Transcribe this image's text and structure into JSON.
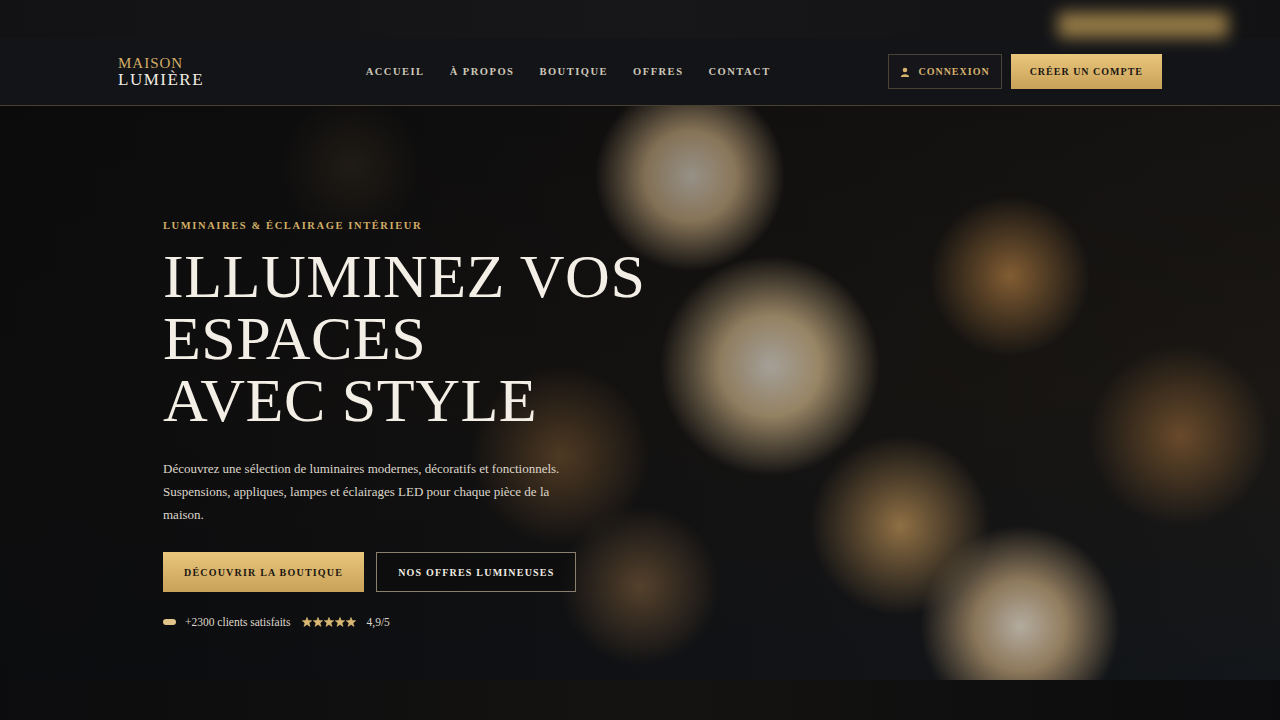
{
  "brand": {
    "line1": "MAISON",
    "line2": "LUMIÈRE"
  },
  "nav": [
    {
      "label": "ACCUEIL"
    },
    {
      "label": "À PROPOS"
    },
    {
      "label": "BOUTIQUE"
    },
    {
      "label": "OFFRES"
    },
    {
      "label": "CONTACT"
    }
  ],
  "account": {
    "login": "CONNEXION",
    "signup": "CRÉER UN COMPTE"
  },
  "hero": {
    "eyebrow": "LUMINAIRES & ÉCLAIRAGE INTÉRIEUR",
    "title_lines": [
      "ILLUMINEZ VOS",
      "ESPACES",
      "AVEC STYLE"
    ],
    "description": "Découvrez une sélection de luminaires modernes, décoratifs et fonctionnels. Suspensions, appliques, lampes et éclairages LED pour chaque pièce de la maison.",
    "buttons": [
      {
        "label": "DÉCOUVRIR LA BOUTIQUE",
        "kind": "primary"
      },
      {
        "label": "NOS OFFRES LUMINEUSES",
        "kind": "outline"
      }
    ],
    "rating": {
      "clients": "+2300 clients satisfaits",
      "stars": 5,
      "score": "4,9/5"
    }
  }
}
